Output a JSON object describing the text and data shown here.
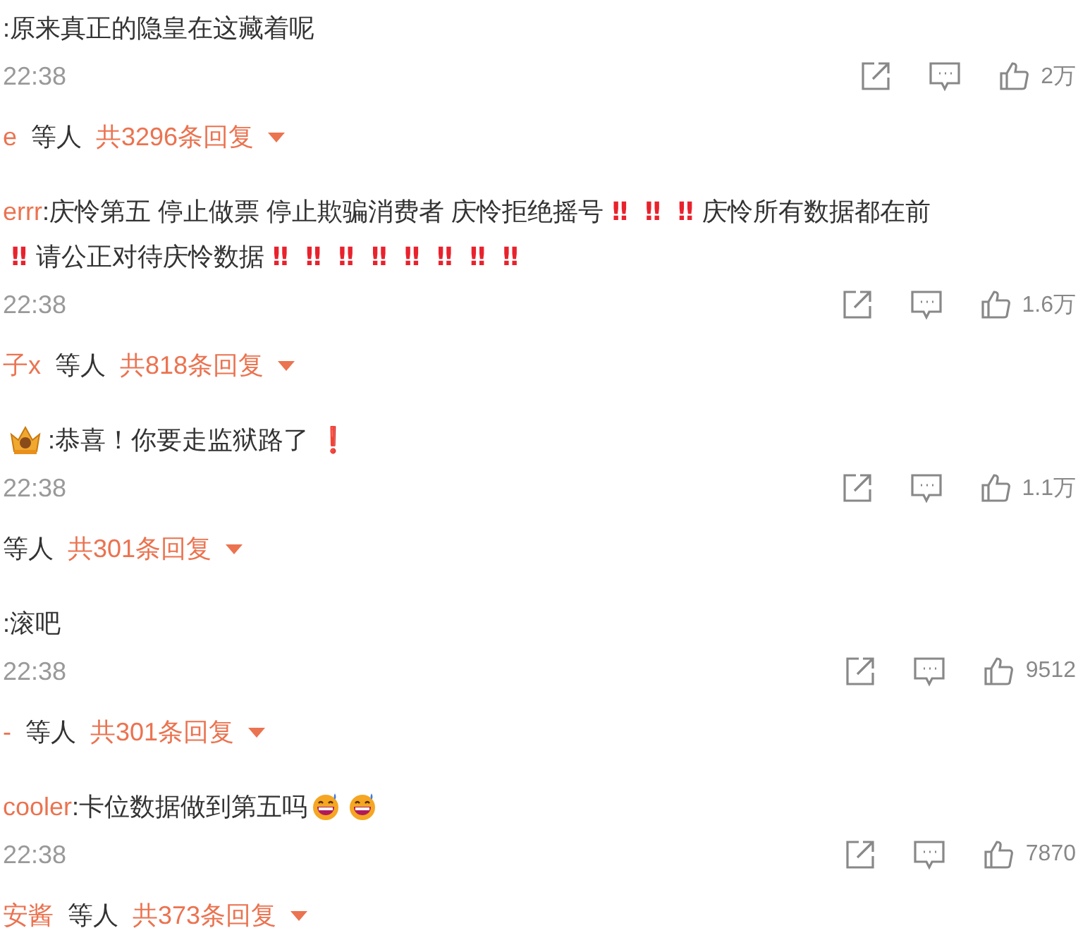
{
  "comments": [
    {
      "lines": [
        [
          {
            "kind": "text",
            "text": ":原来真正的隐皇在这藏着呢"
          }
        ]
      ],
      "time": "22:38",
      "likes": "2万",
      "reply": {
        "users": "e",
        "suffix": "等人",
        "count": "共3296条回复"
      }
    },
    {
      "user": "errr",
      "lines": [
        [
          {
            "kind": "text",
            "text": ":庆怜第五 停止做票 停止欺骗消费者 庆怜拒绝摇号"
          },
          {
            "kind": "exclaim",
            "text": "‼"
          },
          {
            "kind": "exclaim",
            "text": "‼"
          },
          {
            "kind": "exclaim",
            "text": "‼"
          },
          {
            "kind": "text",
            "text": "庆怜所有数据都在前"
          }
        ],
        [
          {
            "kind": "exclaim",
            "text": "‼"
          },
          {
            "kind": "text",
            "text": "请公正对待庆怜数据"
          },
          {
            "kind": "exclaim",
            "text": "‼"
          },
          {
            "kind": "exclaim",
            "text": "‼"
          },
          {
            "kind": "exclaim",
            "text": "‼"
          },
          {
            "kind": "exclaim",
            "text": "‼"
          },
          {
            "kind": "exclaim",
            "text": "‼"
          },
          {
            "kind": "exclaim",
            "text": "‼"
          },
          {
            "kind": "exclaim",
            "text": "‼"
          },
          {
            "kind": "exclaim",
            "text": "‼"
          }
        ]
      ],
      "time": "22:38",
      "likes": "1.6万",
      "reply": {
        "users": "子x",
        "suffix": "等人",
        "count": "共818条回复"
      }
    },
    {
      "lines": [
        [
          {
            "kind": "crown"
          },
          {
            "kind": "text",
            "text": ":恭喜！你要走监狱路了"
          },
          {
            "kind": "exclaim",
            "text": "❗"
          }
        ]
      ],
      "time": "22:38",
      "likes": "1.1万",
      "reply": {
        "suffix": "等人",
        "count": "共301条回复"
      }
    },
    {
      "lines": [
        [
          {
            "kind": "text",
            "text": ":滚吧"
          }
        ]
      ],
      "time": "22:38",
      "likes": "9512",
      "reply": {
        "users": "-",
        "suffix": "等人",
        "count": "共301条回复"
      }
    },
    {
      "user": "cooler",
      "lines": [
        [
          {
            "kind": "text",
            "text": ":卡位数据做到第五吗"
          },
          {
            "kind": "sweat-smile"
          },
          {
            "kind": "sweat-smile"
          }
        ]
      ],
      "time": "22:38",
      "likes": "7870",
      "reply": {
        "users": "安酱",
        "suffix": "等人",
        "count": "共373条回复"
      }
    }
  ]
}
